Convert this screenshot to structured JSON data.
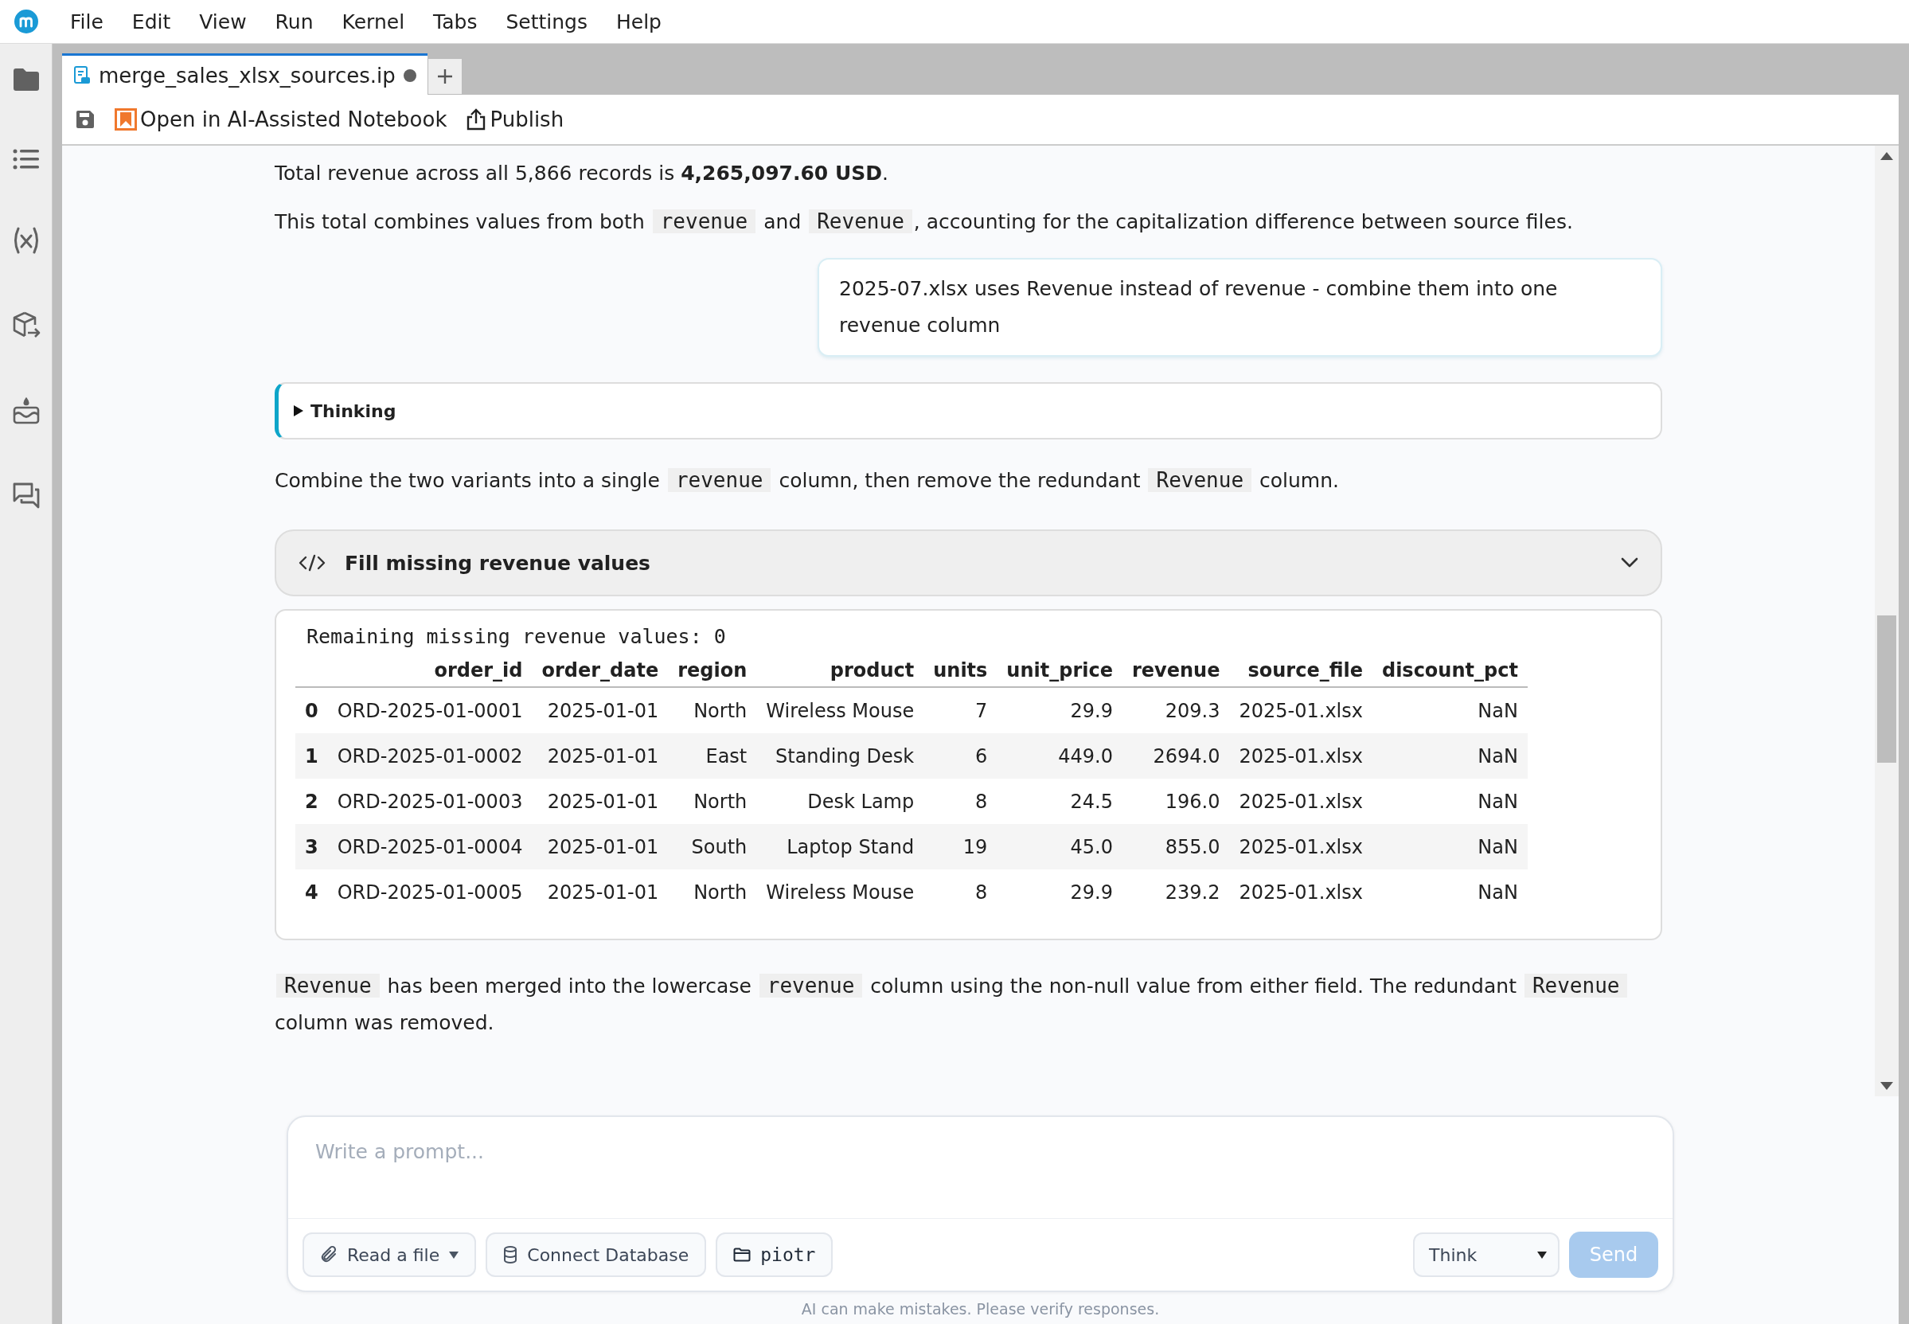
{
  "menu": [
    "File",
    "Edit",
    "View",
    "Run",
    "Kernel",
    "Tabs",
    "Settings",
    "Help"
  ],
  "tab": {
    "title": "merge_sales_xlsx_sources.ip",
    "unsaved": true
  },
  "toolbar": [
    {
      "kind": "save"
    },
    {
      "kind": "notebook",
      "label": "Open in AI-Assisted Notebook"
    },
    {
      "kind": "publish",
      "label": "Publish"
    }
  ],
  "messages": [
    {
      "kind": "paragraph",
      "parts": [
        {
          "kind": "text",
          "text": "Total revenue across all 5,866 records is **4,265,097.60 USD**."
        }
      ]
    },
    {
      "kind": "paragraph",
      "parts": [
        {
          "kind": "text",
          "text": "This total combines values from both "
        },
        {
          "kind": "code",
          "text": "revenue"
        },
        {
          "kind": "text",
          "text": " and "
        },
        {
          "kind": "code",
          "text": "Revenue"
        },
        {
          "kind": "text",
          "text": ", accounting for the capitalization difference between source files."
        }
      ]
    },
    {
      "kind": "user",
      "text": "2025-07.xlsx uses Revenue instead of revenue - combine them into one revenue column"
    },
    {
      "kind": "thinking",
      "label": "Thinking",
      "expanded": false
    },
    {
      "kind": "paragraph",
      "parts": [
        {
          "kind": "text",
          "text": "Combine the two variants into a single "
        },
        {
          "kind": "code",
          "text": "revenue"
        },
        {
          "kind": "text",
          "text": " column, then remove the redundant "
        },
        {
          "kind": "code",
          "text": "Revenue"
        },
        {
          "kind": "text",
          "text": " column."
        }
      ]
    },
    {
      "kind": "tool",
      "label": "Fill missing revenue values",
      "expanded": false
    },
    {
      "kind": "output",
      "stdout": "Remaining missing revenue values: 0",
      "columns": [
        "",
        "order_id",
        "order_date",
        "region",
        "product",
        "units",
        "unit_price",
        "revenue",
        "source_file",
        "discount_pct"
      ],
      "rows": [
        [
          "0",
          "ORD-2025-01-0001",
          "2025-01-01",
          "North",
          "Wireless Mouse",
          "7",
          "29.9",
          "209.3",
          "2025-01.xlsx",
          "NaN"
        ],
        [
          "1",
          "ORD-2025-01-0002",
          "2025-01-01",
          "East",
          "Standing Desk",
          "6",
          "449.0",
          "2694.0",
          "2025-01.xlsx",
          "NaN"
        ],
        [
          "2",
          "ORD-2025-01-0003",
          "2025-01-01",
          "North",
          "Desk Lamp",
          "8",
          "24.5",
          "196.0",
          "2025-01.xlsx",
          "NaN"
        ],
        [
          "3",
          "ORD-2025-01-0004",
          "2025-01-01",
          "South",
          "Laptop Stand",
          "19",
          "45.0",
          "855.0",
          "2025-01.xlsx",
          "NaN"
        ],
        [
          "4",
          "ORD-2025-01-0005",
          "2025-01-01",
          "North",
          "Wireless Mouse",
          "8",
          "29.9",
          "239.2",
          "2025-01.xlsx",
          "NaN"
        ]
      ]
    },
    {
      "kind": "paragraph",
      "parts": [
        {
          "kind": "code",
          "text": "Revenue"
        },
        {
          "kind": "text",
          "text": " has been merged into the lowercase "
        },
        {
          "kind": "code",
          "text": "revenue"
        },
        {
          "kind": "text",
          "text": " column using the non-null value from either field. The redundant "
        },
        {
          "kind": "code",
          "text": "Revenue"
        },
        {
          "kind": "text",
          "text": " column was removed."
        }
      ]
    }
  ],
  "prompt": {
    "placeholder": "Write a prompt...",
    "buttons": [
      {
        "kind": "file",
        "label": "Read a file"
      },
      {
        "kind": "database",
        "label": "Connect Database"
      },
      {
        "kind": "folder",
        "label": "piotr"
      }
    ],
    "mode": "Think",
    "send": {
      "label": "Send",
      "disabled": true
    }
  },
  "note": "AI can make mistakes. Please verify responses."
}
